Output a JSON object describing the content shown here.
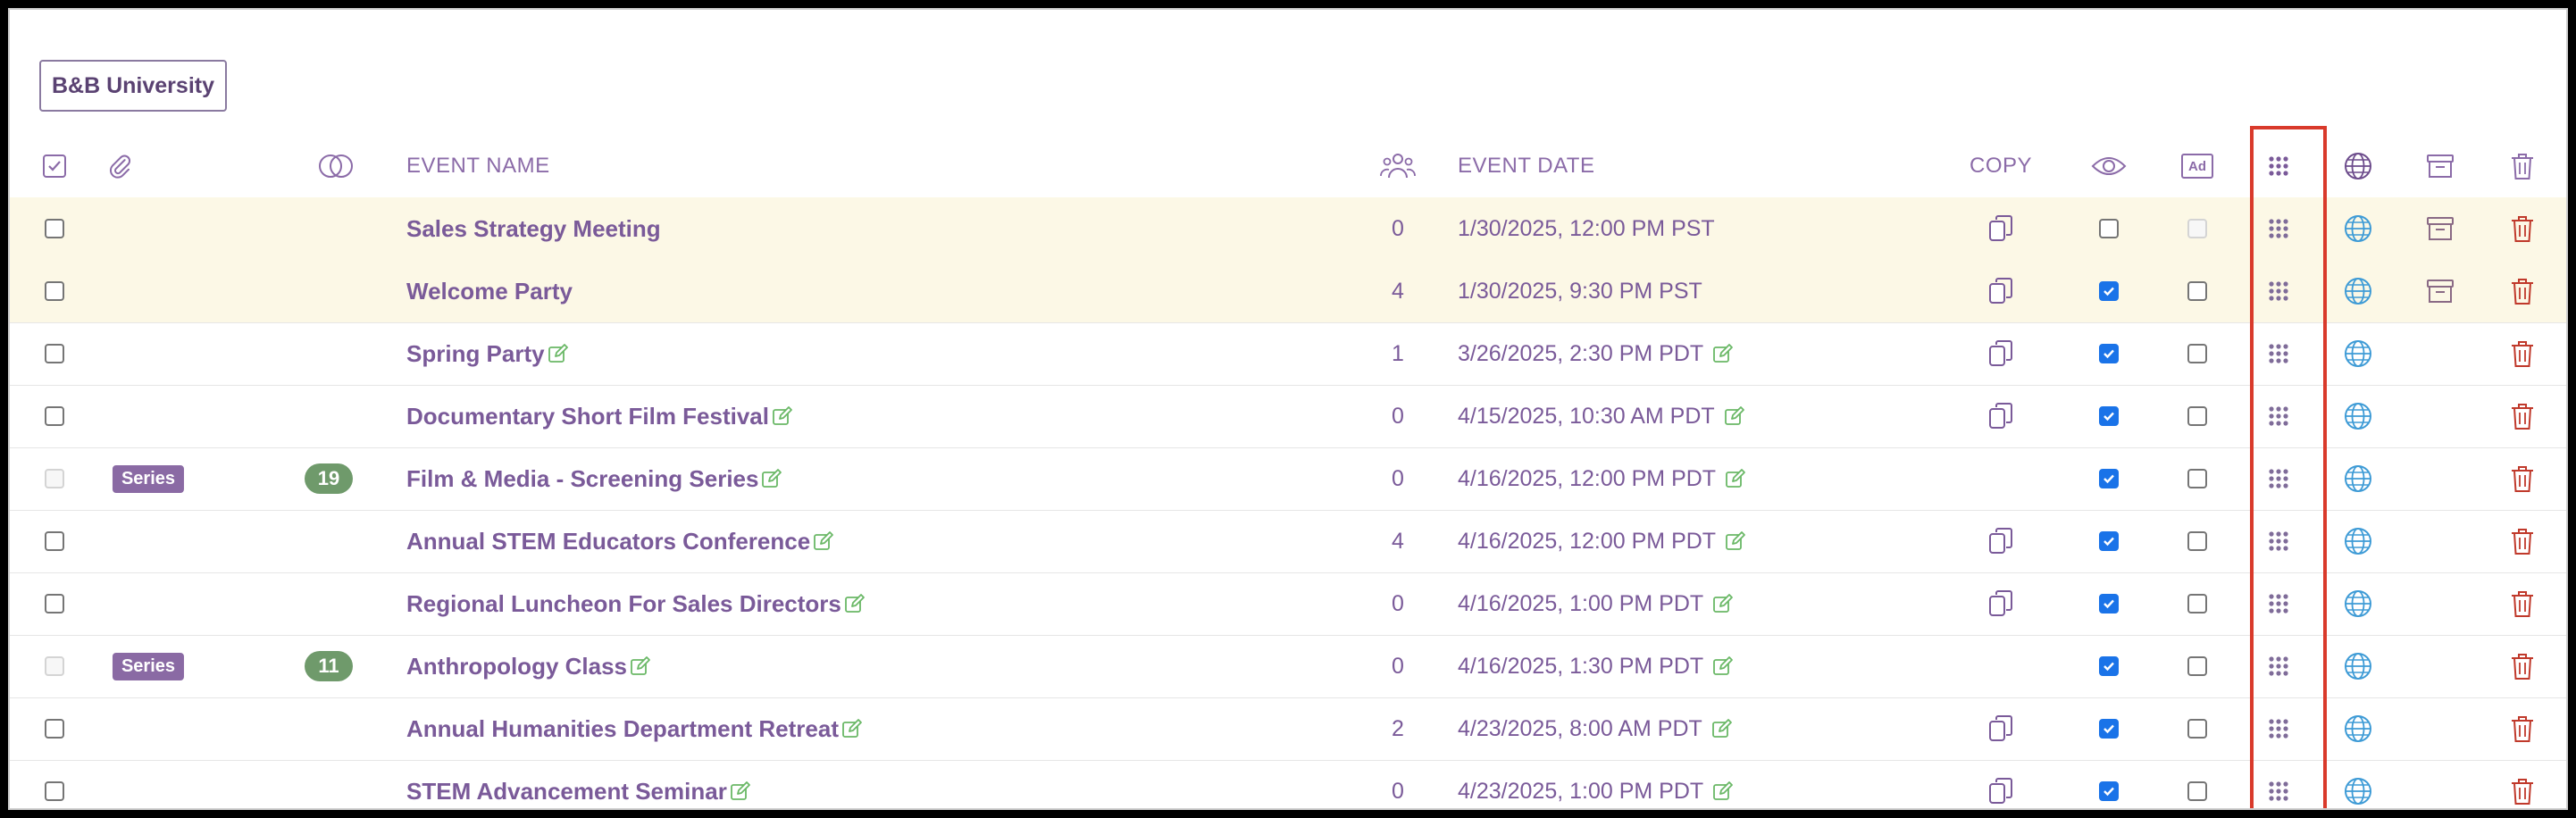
{
  "org_button": {
    "label": "B&B University"
  },
  "header": {
    "event_name": "EVENT NAME",
    "event_date": "EVENT DATE",
    "copy": "COPY",
    "ad_icon_text": "Ad"
  },
  "series_label": "Series",
  "colors": {
    "accent_purple": "#7a5a99",
    "highlight_row": "#fcf8e6",
    "series_badge": "#8a6aa4",
    "count_badge": "#6f9a6b",
    "globe": "#3e9bd6",
    "trash": "#c0392b",
    "checkbox_checked": "#1a73e8",
    "focus_box": "#d93a2b"
  },
  "rows": [
    {
      "name": "Sales Strategy Meeting",
      "attendees": "0",
      "date": "1/30/2025, 12:00 PM PST",
      "editable": false,
      "highlight": true,
      "series": false,
      "series_count": "",
      "select_disabled": false,
      "copy": true,
      "visible": false,
      "ad": false,
      "ad_disabled": true,
      "archive": true
    },
    {
      "name": "Welcome Party",
      "attendees": "4",
      "date": "1/30/2025, 9:30 PM PST",
      "editable": false,
      "highlight": true,
      "series": false,
      "series_count": "",
      "select_disabled": false,
      "copy": true,
      "visible": true,
      "ad": false,
      "ad_disabled": false,
      "archive": true
    },
    {
      "name": "Spring Party",
      "attendees": "1",
      "date": "3/26/2025, 2:30 PM PDT",
      "editable": true,
      "highlight": false,
      "series": false,
      "series_count": "",
      "select_disabled": false,
      "copy": true,
      "visible": true,
      "ad": false,
      "ad_disabled": false,
      "archive": false
    },
    {
      "name": "Documentary Short Film Festival",
      "attendees": "0",
      "date": "4/15/2025, 10:30 AM PDT",
      "editable": true,
      "highlight": false,
      "series": false,
      "series_count": "",
      "select_disabled": false,
      "copy": true,
      "visible": true,
      "ad": false,
      "ad_disabled": false,
      "archive": false
    },
    {
      "name": "Film & Media - Screening Series",
      "attendees": "0",
      "date": "4/16/2025, 12:00 PM PDT",
      "editable": true,
      "highlight": false,
      "series": true,
      "series_count": "19",
      "select_disabled": true,
      "copy": false,
      "visible": true,
      "ad": false,
      "ad_disabled": false,
      "archive": false
    },
    {
      "name": "Annual STEM Educators Conference",
      "attendees": "4",
      "date": "4/16/2025, 12:00 PM PDT",
      "editable": true,
      "highlight": false,
      "series": false,
      "series_count": "",
      "select_disabled": false,
      "copy": true,
      "visible": true,
      "ad": false,
      "ad_disabled": false,
      "archive": false
    },
    {
      "name": "Regional Luncheon For Sales Directors",
      "attendees": "0",
      "date": "4/16/2025, 1:00 PM PDT",
      "editable": true,
      "highlight": false,
      "series": false,
      "series_count": "",
      "select_disabled": false,
      "copy": true,
      "visible": true,
      "ad": false,
      "ad_disabled": false,
      "archive": false
    },
    {
      "name": "Anthropology Class",
      "attendees": "0",
      "date": "4/16/2025, 1:30 PM PDT",
      "editable": true,
      "highlight": false,
      "series": true,
      "series_count": "11",
      "select_disabled": true,
      "copy": false,
      "visible": true,
      "ad": false,
      "ad_disabled": false,
      "archive": false
    },
    {
      "name": "Annual Humanities Department Retreat",
      "attendees": "2",
      "date": "4/23/2025, 8:00 AM PDT",
      "editable": true,
      "highlight": false,
      "series": false,
      "series_count": "",
      "select_disabled": false,
      "copy": true,
      "visible": true,
      "ad": false,
      "ad_disabled": false,
      "archive": false
    },
    {
      "name": "STEM Advancement Seminar",
      "attendees": "0",
      "date": "4/23/2025, 1:00 PM PDT",
      "editable": true,
      "highlight": false,
      "series": false,
      "series_count": "",
      "select_disabled": false,
      "copy": true,
      "visible": true,
      "ad": false,
      "ad_disabled": false,
      "archive": false
    }
  ]
}
